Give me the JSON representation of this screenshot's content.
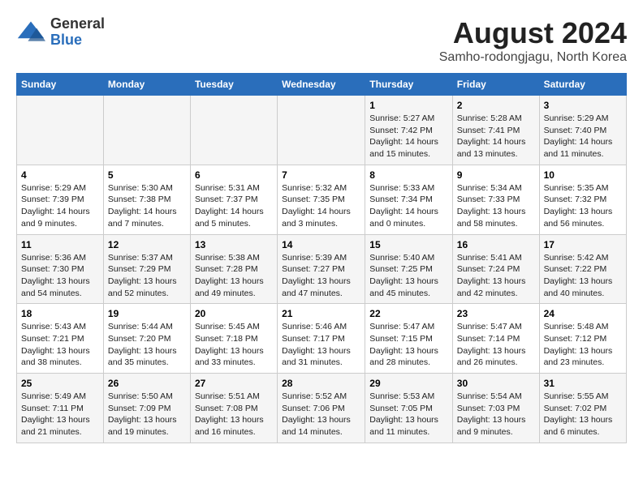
{
  "header": {
    "logo_general": "General",
    "logo_blue": "Blue",
    "title": "August 2024",
    "subtitle": "Samho-rodongjagu, North Korea"
  },
  "calendar": {
    "weekdays": [
      "Sunday",
      "Monday",
      "Tuesday",
      "Wednesday",
      "Thursday",
      "Friday",
      "Saturday"
    ],
    "weeks": [
      [
        {
          "day": "",
          "detail": ""
        },
        {
          "day": "",
          "detail": ""
        },
        {
          "day": "",
          "detail": ""
        },
        {
          "day": "",
          "detail": ""
        },
        {
          "day": "1",
          "detail": "Sunrise: 5:27 AM\nSunset: 7:42 PM\nDaylight: 14 hours and 15 minutes."
        },
        {
          "day": "2",
          "detail": "Sunrise: 5:28 AM\nSunset: 7:41 PM\nDaylight: 14 hours and 13 minutes."
        },
        {
          "day": "3",
          "detail": "Sunrise: 5:29 AM\nSunset: 7:40 PM\nDaylight: 14 hours and 11 minutes."
        }
      ],
      [
        {
          "day": "4",
          "detail": "Sunrise: 5:29 AM\nSunset: 7:39 PM\nDaylight: 14 hours and 9 minutes."
        },
        {
          "day": "5",
          "detail": "Sunrise: 5:30 AM\nSunset: 7:38 PM\nDaylight: 14 hours and 7 minutes."
        },
        {
          "day": "6",
          "detail": "Sunrise: 5:31 AM\nSunset: 7:37 PM\nDaylight: 14 hours and 5 minutes."
        },
        {
          "day": "7",
          "detail": "Sunrise: 5:32 AM\nSunset: 7:35 PM\nDaylight: 14 hours and 3 minutes."
        },
        {
          "day": "8",
          "detail": "Sunrise: 5:33 AM\nSunset: 7:34 PM\nDaylight: 14 hours and 0 minutes."
        },
        {
          "day": "9",
          "detail": "Sunrise: 5:34 AM\nSunset: 7:33 PM\nDaylight: 13 hours and 58 minutes."
        },
        {
          "day": "10",
          "detail": "Sunrise: 5:35 AM\nSunset: 7:32 PM\nDaylight: 13 hours and 56 minutes."
        }
      ],
      [
        {
          "day": "11",
          "detail": "Sunrise: 5:36 AM\nSunset: 7:30 PM\nDaylight: 13 hours and 54 minutes."
        },
        {
          "day": "12",
          "detail": "Sunrise: 5:37 AM\nSunset: 7:29 PM\nDaylight: 13 hours and 52 minutes."
        },
        {
          "day": "13",
          "detail": "Sunrise: 5:38 AM\nSunset: 7:28 PM\nDaylight: 13 hours and 49 minutes."
        },
        {
          "day": "14",
          "detail": "Sunrise: 5:39 AM\nSunset: 7:27 PM\nDaylight: 13 hours and 47 minutes."
        },
        {
          "day": "15",
          "detail": "Sunrise: 5:40 AM\nSunset: 7:25 PM\nDaylight: 13 hours and 45 minutes."
        },
        {
          "day": "16",
          "detail": "Sunrise: 5:41 AM\nSunset: 7:24 PM\nDaylight: 13 hours and 42 minutes."
        },
        {
          "day": "17",
          "detail": "Sunrise: 5:42 AM\nSunset: 7:22 PM\nDaylight: 13 hours and 40 minutes."
        }
      ],
      [
        {
          "day": "18",
          "detail": "Sunrise: 5:43 AM\nSunset: 7:21 PM\nDaylight: 13 hours and 38 minutes."
        },
        {
          "day": "19",
          "detail": "Sunrise: 5:44 AM\nSunset: 7:20 PM\nDaylight: 13 hours and 35 minutes."
        },
        {
          "day": "20",
          "detail": "Sunrise: 5:45 AM\nSunset: 7:18 PM\nDaylight: 13 hours and 33 minutes."
        },
        {
          "day": "21",
          "detail": "Sunrise: 5:46 AM\nSunset: 7:17 PM\nDaylight: 13 hours and 31 minutes."
        },
        {
          "day": "22",
          "detail": "Sunrise: 5:47 AM\nSunset: 7:15 PM\nDaylight: 13 hours and 28 minutes."
        },
        {
          "day": "23",
          "detail": "Sunrise: 5:47 AM\nSunset: 7:14 PM\nDaylight: 13 hours and 26 minutes."
        },
        {
          "day": "24",
          "detail": "Sunrise: 5:48 AM\nSunset: 7:12 PM\nDaylight: 13 hours and 23 minutes."
        }
      ],
      [
        {
          "day": "25",
          "detail": "Sunrise: 5:49 AM\nSunset: 7:11 PM\nDaylight: 13 hours and 21 minutes."
        },
        {
          "day": "26",
          "detail": "Sunrise: 5:50 AM\nSunset: 7:09 PM\nDaylight: 13 hours and 19 minutes."
        },
        {
          "day": "27",
          "detail": "Sunrise: 5:51 AM\nSunset: 7:08 PM\nDaylight: 13 hours and 16 minutes."
        },
        {
          "day": "28",
          "detail": "Sunrise: 5:52 AM\nSunset: 7:06 PM\nDaylight: 13 hours and 14 minutes."
        },
        {
          "day": "29",
          "detail": "Sunrise: 5:53 AM\nSunset: 7:05 PM\nDaylight: 13 hours and 11 minutes."
        },
        {
          "day": "30",
          "detail": "Sunrise: 5:54 AM\nSunset: 7:03 PM\nDaylight: 13 hours and 9 minutes."
        },
        {
          "day": "31",
          "detail": "Sunrise: 5:55 AM\nSunset: 7:02 PM\nDaylight: 13 hours and 6 minutes."
        }
      ]
    ]
  }
}
